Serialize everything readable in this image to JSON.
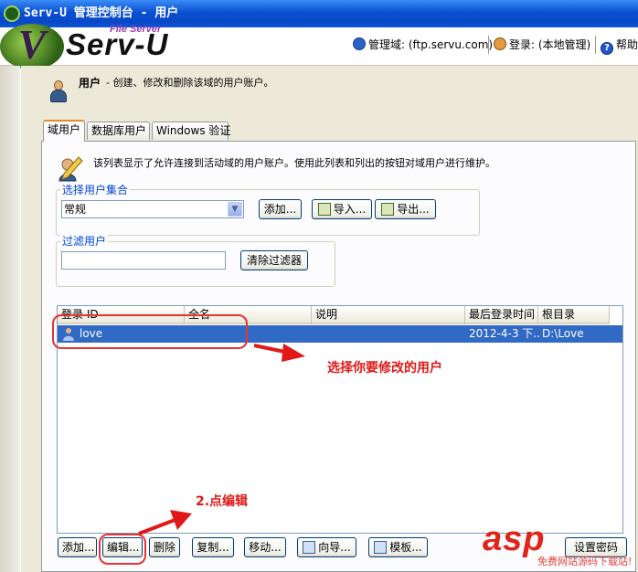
{
  "window": {
    "title": "Serv-U 管理控制台 - 用户"
  },
  "header": {
    "logo_text": "Serv-U",
    "logo_sub": "File Server",
    "domain_label": "管理域: (ftp.servu.com)",
    "login_label": "登录: (本地管理)",
    "help_label": "帮助"
  },
  "page": {
    "title": "用户",
    "description": "- 创建、修改和删除该域的用户账户。"
  },
  "tabs": [
    {
      "label": "域用户",
      "active": true
    },
    {
      "label": "数据库用户",
      "active": false
    },
    {
      "label": "Windows 验证",
      "active": false
    }
  ],
  "panel": {
    "description": "该列表显示了允许连接到活动域的用户账户。使用此列表和列出的按钮对域用户进行维护。",
    "user_set": {
      "legend": "选择用户集合",
      "selected": "常规",
      "add_button": "添加...",
      "import_button": "导入...",
      "export_button": "导出..."
    },
    "filter": {
      "legend": "过滤用户",
      "value": "",
      "clear_button": "清除过滤器"
    },
    "table": {
      "columns": [
        "登录 ID",
        "全名",
        "说明",
        "最后登录时间",
        "根目录"
      ],
      "rows": [
        {
          "login_id": "love",
          "full_name": "",
          "description": "",
          "last_login": "2012-4-3 下...",
          "root": "D:\\Love"
        }
      ]
    },
    "bottom_buttons": {
      "add": "添加...",
      "edit": "编辑...",
      "delete": "删除",
      "copy": "复制...",
      "move": "移动...",
      "wizard": "向导...",
      "template": "模板...",
      "set_password": "设置密码"
    }
  },
  "annotations": {
    "select_user": "选择你要修改的用户",
    "click_edit": "2.点编辑"
  },
  "watermark": {
    "brand": "asp",
    "sub": "免费网站源码下载站!"
  },
  "colors": {
    "title_bar": "#0a4fd0",
    "selection": "#316ac5",
    "annotation": "#e01818",
    "tab_accent": "#e68b2c"
  }
}
